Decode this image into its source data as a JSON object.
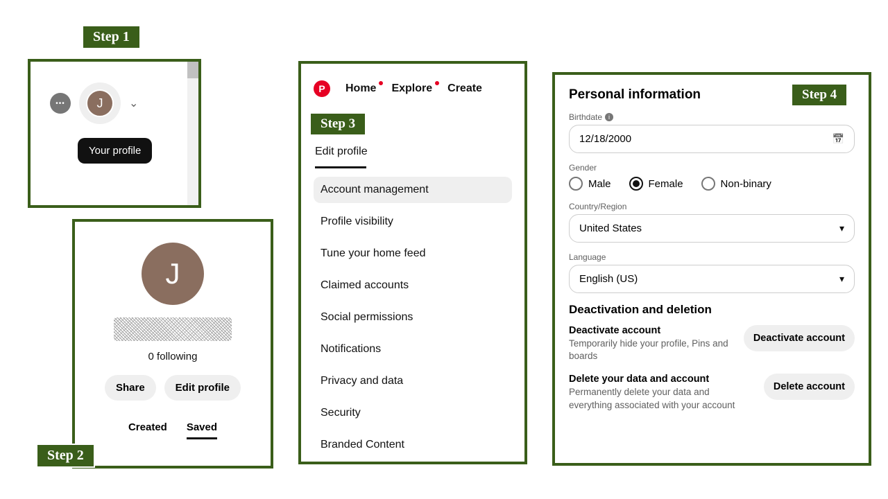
{
  "badges": {
    "s1": "Step 1",
    "s2": "Step 2",
    "s3": "Step 3",
    "s4": "Step 4"
  },
  "step1": {
    "avatar_initial": "J",
    "tooltip": "Your profile"
  },
  "step2": {
    "avatar_initial": "J",
    "following": "0 following",
    "share_btn": "Share",
    "edit_btn": "Edit profile",
    "tab_created": "Created",
    "tab_saved": "Saved"
  },
  "step3": {
    "logo_letter": "P",
    "nav": {
      "home": "Home",
      "explore": "Explore",
      "create": "Create"
    },
    "menu": [
      "Edit profile",
      "Account management",
      "Profile visibility",
      "Tune your home feed",
      "Claimed accounts",
      "Social permissions",
      "Notifications",
      "Privacy and data",
      "Security",
      "Branded Content"
    ]
  },
  "step4": {
    "title": "Personal information",
    "birthdate_label": "Birthdate",
    "birthdate_value": "12/18/2000",
    "gender_label": "Gender",
    "gender": {
      "male": "Male",
      "female": "Female",
      "nonbinary": "Non-binary",
      "selected": "female"
    },
    "country_label": "Country/Region",
    "country_value": "United States",
    "language_label": "Language",
    "language_value": "English (US)",
    "deact_section": "Deactivation and deletion",
    "deactivate": {
      "head": "Deactivate account",
      "sub": "Temporarily hide your profile, Pins and boards",
      "btn": "Deactivate account"
    },
    "delete": {
      "head": "Delete your data and account",
      "sub": "Permanently delete your data and everything associated with your account",
      "btn": "Delete account"
    }
  }
}
